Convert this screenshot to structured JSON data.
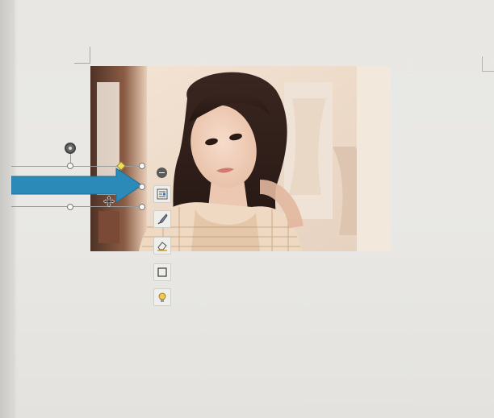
{
  "document": {
    "kind": "word-processor-canvas"
  },
  "image": {
    "description_name": "portrait-photo"
  },
  "shape": {
    "type": "right-arrow",
    "fill_color": "#2b8ab8"
  },
  "quick_toolbar": {
    "buttons": [
      {
        "name": "layout-options-button",
        "icon": "layout-icon"
      },
      {
        "name": "shape-fill-button",
        "icon": "brush-icon"
      },
      {
        "name": "shape-outline-button",
        "icon": "eraser-icon"
      },
      {
        "name": "border-button",
        "icon": "square-outline-icon"
      },
      {
        "name": "effects-button",
        "icon": "lightbulb-icon"
      }
    ],
    "collapse_icon": "minus-circle-icon"
  },
  "colors": {
    "arrow": "#2b8ab8",
    "handle": "#fafafa",
    "adjust_handle": "#f0e060"
  }
}
